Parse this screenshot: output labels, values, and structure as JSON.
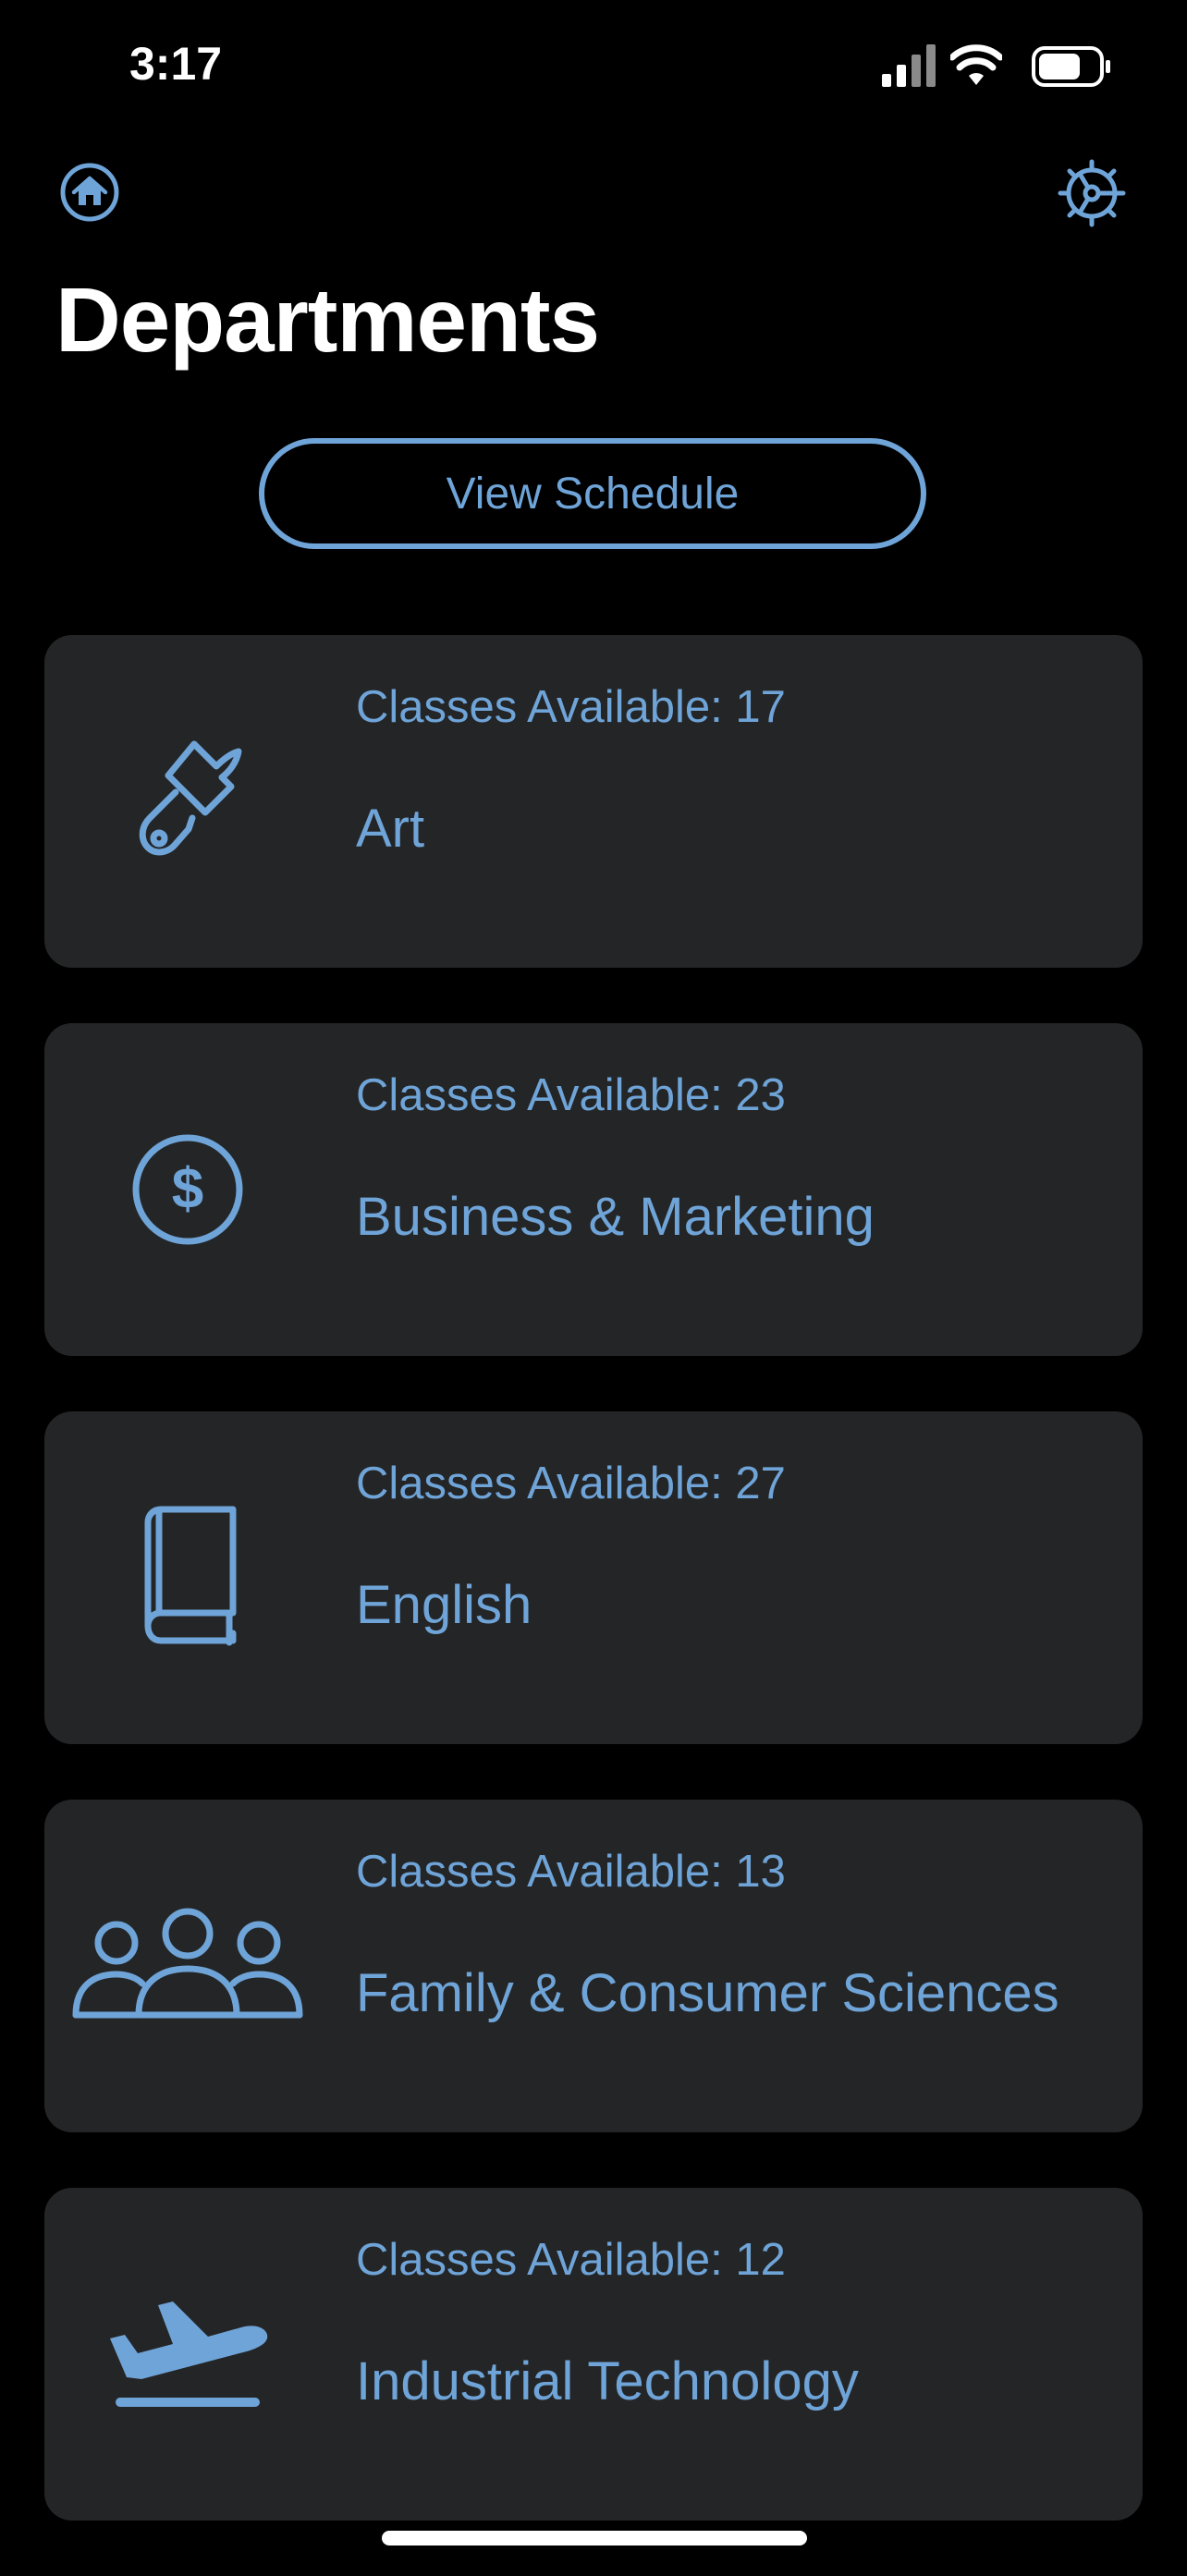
{
  "status_bar": {
    "time": "3:17"
  },
  "header": {
    "home_icon": "house-circle-icon",
    "settings_icon": "gear-icon",
    "title": "Departments"
  },
  "actions": {
    "view_schedule_label": "View Schedule"
  },
  "departments": [
    {
      "icon": "paintbrush-icon",
      "count_label": "Classes Available: 17",
      "name": "Art"
    },
    {
      "icon": "dollar-circle-icon",
      "count_label": "Classes Available: 23",
      "name": "Business & Marketing"
    },
    {
      "icon": "book-icon",
      "count_label": "Classes Available: 27",
      "name": "English"
    },
    {
      "icon": "people-icon",
      "count_label": "Classes Available: 13",
      "name": "Family & Consumer Sciences"
    },
    {
      "icon": "airplane-departure-icon",
      "count_label": "Classes Available: 12",
      "name": "Industrial Technology"
    }
  ],
  "colors": {
    "background": "#000000",
    "card": "#242526",
    "accent": "#6FA4D8",
    "text": "#FFFFFF"
  }
}
